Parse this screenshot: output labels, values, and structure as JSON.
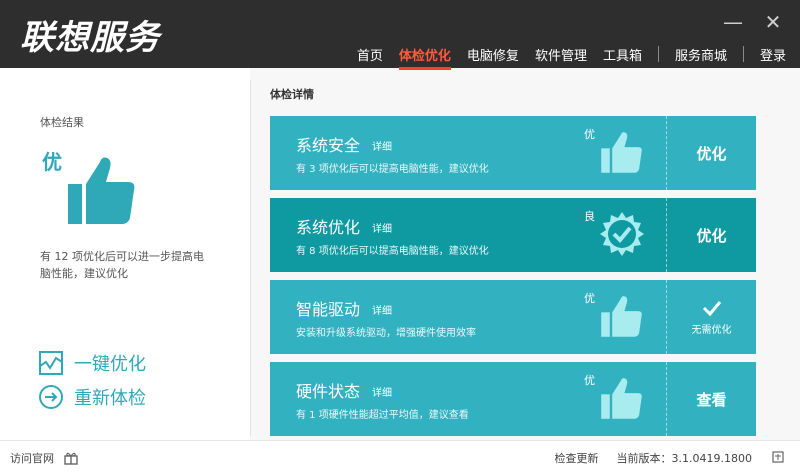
{
  "app": {
    "logo": "联想服务"
  },
  "window": {
    "minimize": "—",
    "close": "✕"
  },
  "nav": {
    "items": [
      {
        "label": "首页"
      },
      {
        "label": "体检优化"
      },
      {
        "label": "电脑修复"
      },
      {
        "label": "软件管理"
      },
      {
        "label": "工具箱"
      },
      {
        "label": "服务商城"
      },
      {
        "label": "登录"
      }
    ]
  },
  "result": {
    "title": "体检结果",
    "grade": "优",
    "desc": "有 12 项优化后可以进一步提高电脑性能，建议优化"
  },
  "actions": {
    "optimize": "一键优化",
    "recheck": "重新体检"
  },
  "detail": {
    "title": "体检详情",
    "cards": [
      {
        "name": "系统安全",
        "link": "详细",
        "desc": "有 3 项优化后可以提高电脑性能，建议优化",
        "grade": "优",
        "button": "优化"
      },
      {
        "name": "系统优化",
        "link": "详细",
        "desc": "有 8 项优化后可以提高电脑性能，建议优化",
        "grade": "良",
        "button": "优化"
      },
      {
        "name": "智能驱动",
        "link": "详细",
        "desc": "安装和升级系统驱动，增强硬件使用效率",
        "grade": "优",
        "button": "无需优化"
      },
      {
        "name": "硬件状态",
        "link": "详细",
        "desc": "有 1 项硬件性能超过平均值，建议查看",
        "grade": "优",
        "button": "查看"
      }
    ]
  },
  "bottom": {
    "visit": "访问官网",
    "check_update": "检查更新",
    "version": "当前版本：3.1.0419.1800"
  },
  "colors": {
    "accent": "#2fa9b8",
    "card": "#32b2c1",
    "card_dark": "#0f9aa2",
    "nav_active": "#ff5a3c"
  }
}
